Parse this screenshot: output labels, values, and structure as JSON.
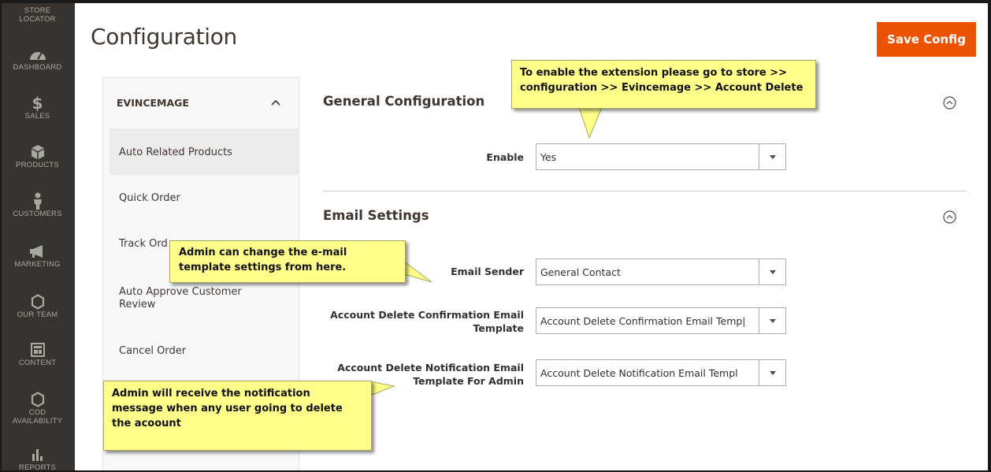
{
  "sidebar": {
    "items": [
      {
        "label": "STORE LOCATOR",
        "icon": "store-locator"
      },
      {
        "label": "DASHBOARD",
        "icon": "speedometer-icon"
      },
      {
        "label": "SALES",
        "icon": "dollar-icon"
      },
      {
        "label": "PRODUCTS",
        "icon": "cube-icon"
      },
      {
        "label": "CUSTOMERS",
        "icon": "person-icon"
      },
      {
        "label": "MARKETING",
        "icon": "megaphone-icon"
      },
      {
        "label": "OUR TEAM",
        "icon": "hexagon-icon"
      },
      {
        "label": "CONTENT",
        "icon": "layout-icon"
      },
      {
        "label": "COD AVAILABILITY",
        "icon": "hexagon-icon"
      },
      {
        "label": "REPORTS",
        "icon": "bar-chart-icon"
      }
    ],
    "sales_symbol": "$"
  },
  "header": {
    "title": "Configuration",
    "save_label": "Save Config"
  },
  "tabs": {
    "group": "EVINCEMAGE",
    "items": [
      "Auto Related Products",
      "Quick Order",
      "Track Ord",
      "Auto Approve Customer Review",
      "Cancel Order"
    ]
  },
  "general": {
    "title": "General Configuration",
    "enable_label": "Enable",
    "enable_value": "Yes"
  },
  "email": {
    "title": "Email Settings",
    "sender_label": "Email Sender",
    "sender_value": "General Contact",
    "confirm_label_1": "Account Delete Confirmation Email",
    "confirm_label_2": "Template",
    "confirm_value": "Account Delete Confirmation Email Temp|",
    "notify_label_1": "Account Delete Notification Email",
    "notify_label_2": "Template For Admin",
    "notify_value": "Account Delete Notification Email Templ"
  },
  "callouts": {
    "top_line1": "To enable the extension please go to store >>",
    "top_line2": "configuration >> Evincemage >> Account Delete",
    "mid_line1": "Admin can change the e-mail",
    "mid_line2": "template settings from here.",
    "bottom_line1": "Admin will receive the notification",
    "bottom_line2": "message when any user going to delete",
    "bottom_line3": "the acoount"
  },
  "colors": {
    "sidebar_bg": "#373330",
    "accent": "#eb5202",
    "callout_bg": "#ffff8a"
  }
}
